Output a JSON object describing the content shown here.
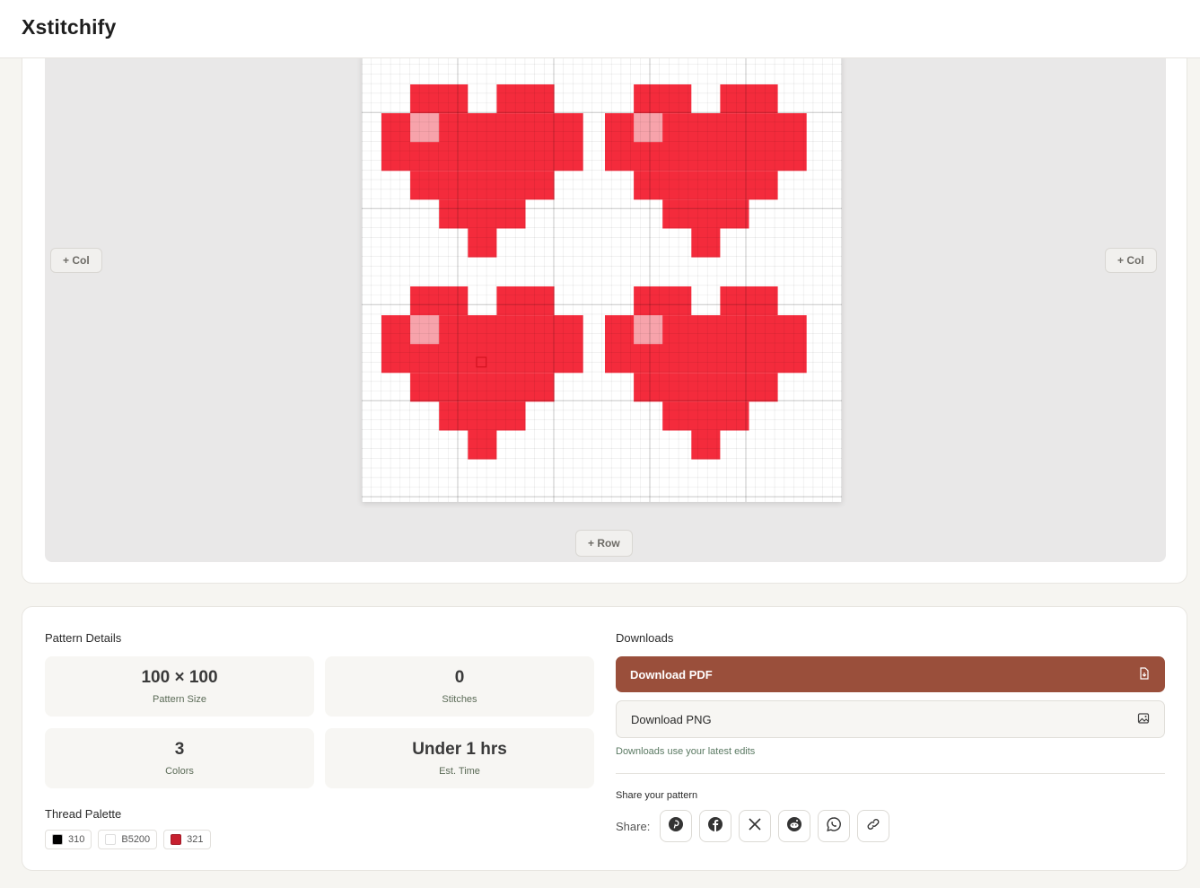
{
  "app": {
    "name": "Xstitchify"
  },
  "editor": {
    "add_col_left": "+ Col",
    "add_col_right": "+ Col",
    "add_row": "+ Row"
  },
  "pattern_details": {
    "title": "Pattern Details",
    "stats": [
      {
        "value": "100 × 100",
        "label": "Pattern Size"
      },
      {
        "value": "0",
        "label": "Stitches"
      },
      {
        "value": "3",
        "label": "Colors"
      },
      {
        "value": "Under 1 hrs",
        "label": "Est. Time"
      }
    ]
  },
  "thread_palette": {
    "title": "Thread Palette",
    "threads": [
      {
        "code": "310",
        "color": "#000000"
      },
      {
        "code": "B5200",
        "color": "#ffffff"
      },
      {
        "code": "321",
        "color": "#c7202f"
      }
    ]
  },
  "downloads": {
    "title": "Downloads",
    "pdf_label": "Download PDF",
    "png_label": "Download PNG",
    "note": "Downloads use your latest edits"
  },
  "share": {
    "title": "Share your pattern",
    "label": "Share:",
    "icons": [
      "pinterest-icon",
      "facebook-icon",
      "x-icon",
      "reddit-icon",
      "whatsapp-icon",
      "link-icon"
    ]
  },
  "colors": {
    "heart_red": "#f42b3c",
    "heart_highlight": "#f7a3ab",
    "accent_brown": "#9a4f3b"
  }
}
